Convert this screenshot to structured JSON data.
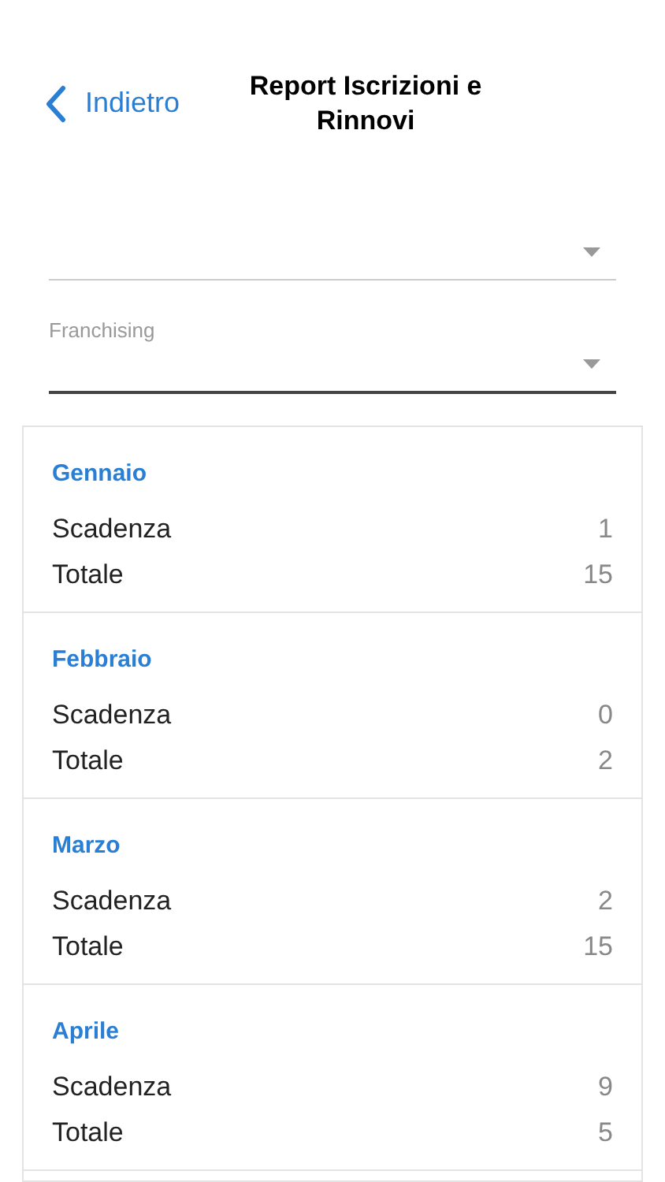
{
  "header": {
    "back_label": "Indietro",
    "title": "Report Iscrizioni e Rinnovi"
  },
  "filters": [
    {
      "focused": false
    },
    {
      "label": "Franchising",
      "focused": true
    }
  ],
  "months": [
    {
      "name": "Gennaio",
      "rows": [
        {
          "label": "Scadenza",
          "value": "1"
        },
        {
          "label": "Totale",
          "value": "15"
        }
      ]
    },
    {
      "name": "Febbraio",
      "rows": [
        {
          "label": "Scadenza",
          "value": "0"
        },
        {
          "label": "Totale",
          "value": "2"
        }
      ]
    },
    {
      "name": "Marzo",
      "rows": [
        {
          "label": "Scadenza",
          "value": "2"
        },
        {
          "label": "Totale",
          "value": "15"
        }
      ]
    },
    {
      "name": "Aprile",
      "rows": [
        {
          "label": "Scadenza",
          "value": "9"
        },
        {
          "label": "Totale",
          "value": "5"
        }
      ]
    }
  ]
}
